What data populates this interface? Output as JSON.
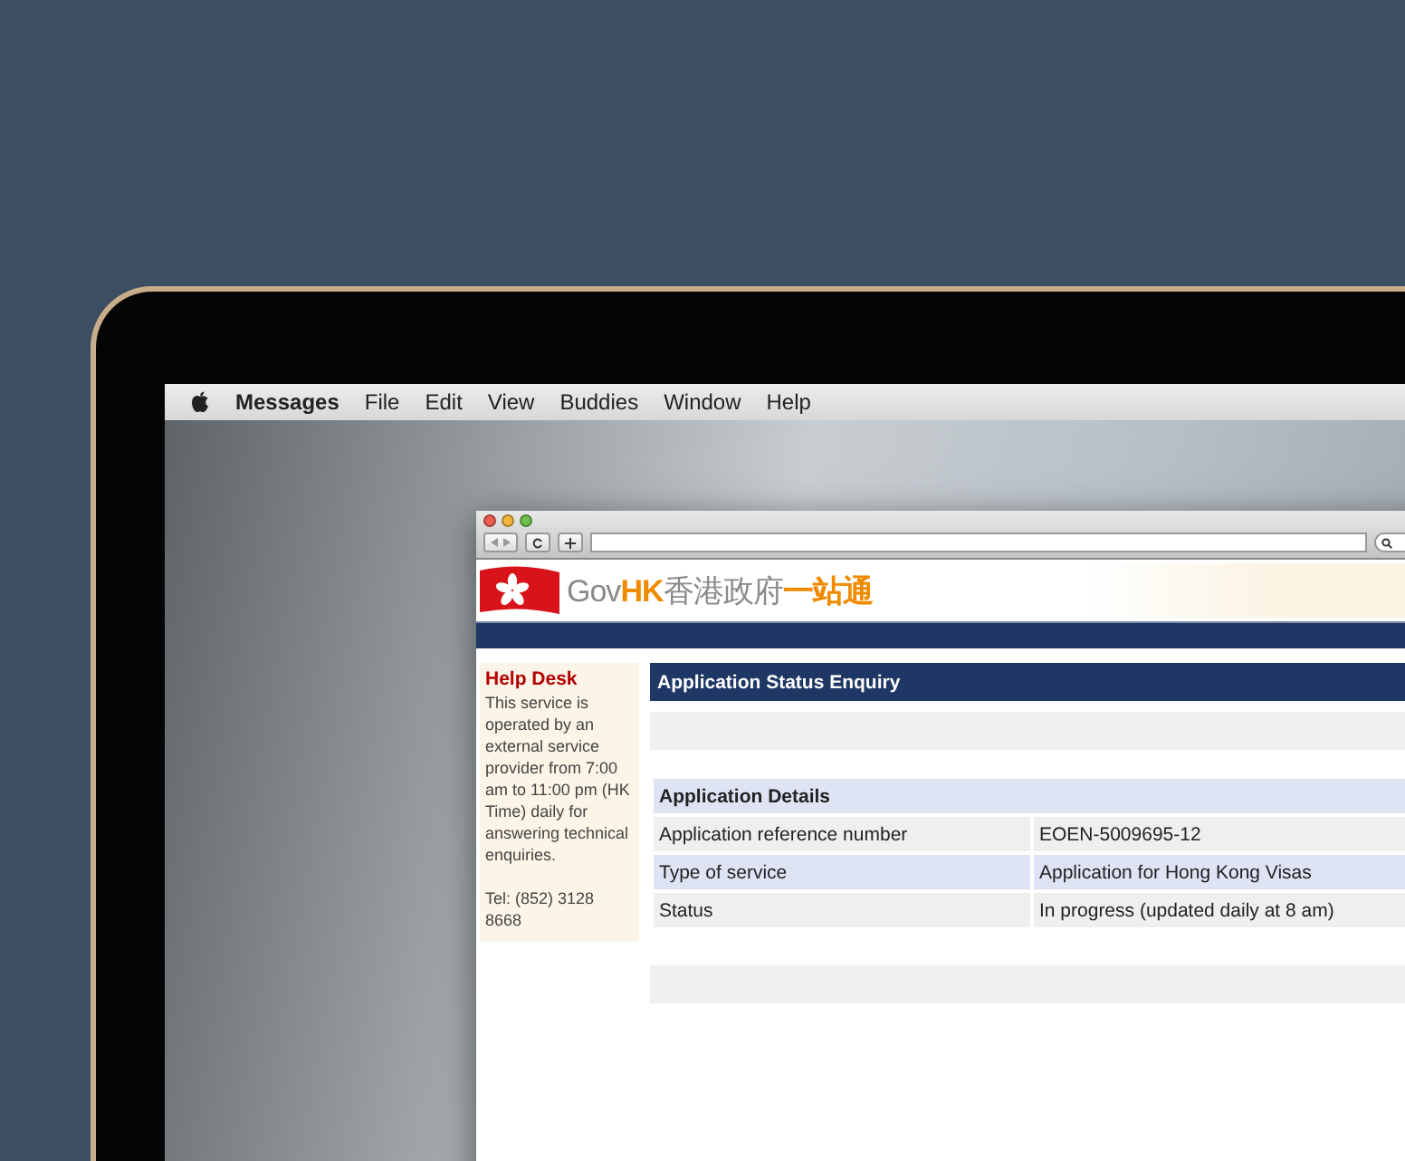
{
  "menu_bar": {
    "items": [
      {
        "label": "Messages",
        "selected": true
      },
      {
        "label": "File",
        "selected": false
      },
      {
        "label": "Edit",
        "selected": false
      },
      {
        "label": "View",
        "selected": false
      },
      {
        "label": "Buddies",
        "selected": false
      },
      {
        "label": "Window",
        "selected": false
      },
      {
        "label": "Help",
        "selected": false
      }
    ]
  },
  "browser": {
    "logo": [
      {
        "text": "Gov",
        "kind": "plain"
      },
      {
        "text": "HK",
        "kind": "accent"
      },
      {
        "text": "香港政府",
        "kind": "plain"
      },
      {
        "text": "一站通",
        "kind": "accent"
      }
    ],
    "help_desk": {
      "title": "Help Desk",
      "text": "This service is operated by an external service provider from 7:00 am to 11:00 pm (HK Time) daily for answering technical enquiries.",
      "phone": "Tel: (852) 3128 8668"
    },
    "heading": "Application Status Enquiry",
    "details": {
      "title": "Application Details",
      "rows": [
        {
          "label": "Application reference number",
          "value": "EOEN-5009695-12"
        },
        {
          "label": "Type of service",
          "value": "Application for Hong Kong Visas"
        },
        {
          "label": "Status",
          "value": "In progress (updated daily at 8 am)"
        }
      ]
    }
  }
}
